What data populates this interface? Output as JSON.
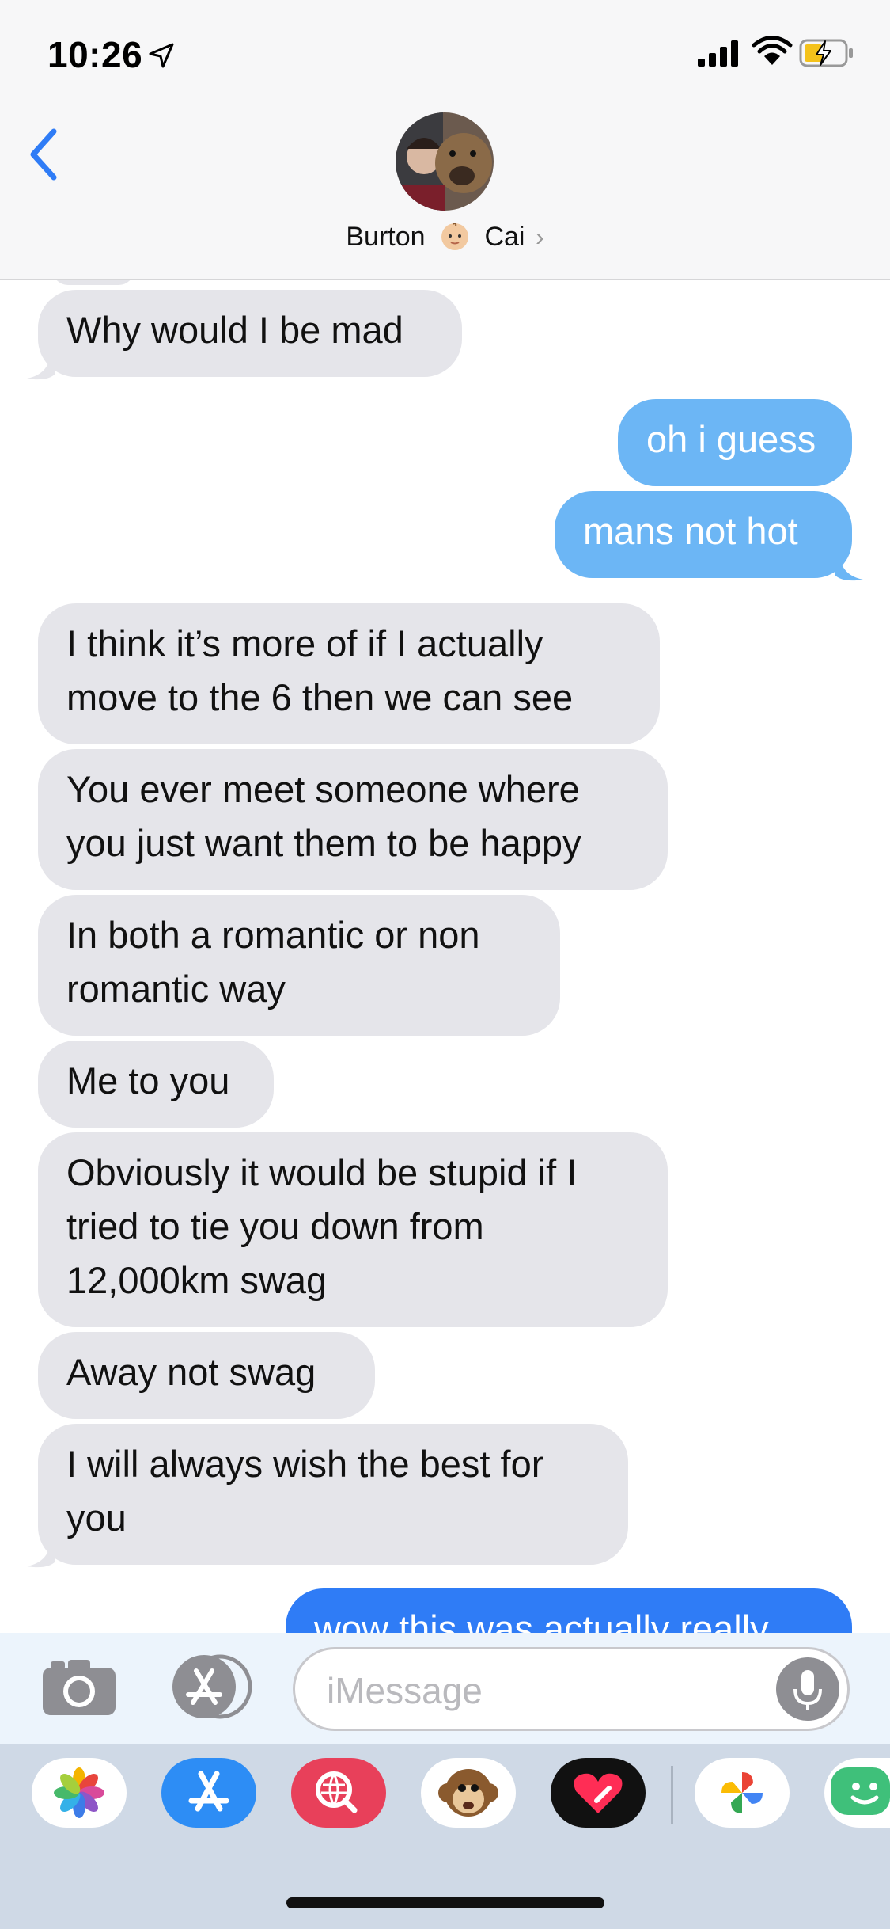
{
  "status_bar": {
    "time": "10:26"
  },
  "header": {
    "contact_name_1": "Burton",
    "contact_name_2": "Cai",
    "chevron": "›"
  },
  "messages": [
    {
      "dir": "recv",
      "text": "Why would I be mad"
    },
    {
      "dir": "sent",
      "text": "oh i guess"
    },
    {
      "dir": "sent",
      "text": "mans not hot"
    },
    {
      "dir": "recv",
      "text": "I think it’s more of if I actually\nmove to the 6 then we can see"
    },
    {
      "dir": "recv",
      "text": "You ever meet someone where\nyou just want them to be happy"
    },
    {
      "dir": "recv",
      "text": "In both a romantic or non\nromantic way"
    },
    {
      "dir": "recv",
      "text": "Me to you"
    },
    {
      "dir": "recv",
      "text": "Obviously it would be stupid if I\ntried to tie you down from\n12,000km swag"
    },
    {
      "dir": "recv",
      "text": "Away not swag"
    },
    {
      "dir": "recv",
      "text": "I will always wish the best for\nyou"
    },
    {
      "dir": "sent",
      "text": "wow this was actually really"
    }
  ],
  "composer": {
    "placeholder": "iMessage"
  },
  "icons": {
    "status": [
      "location-arrow-icon",
      "signal-icon",
      "wifi-icon",
      "battery-charging-icon"
    ],
    "header": [
      "back-chevron-icon",
      "avatar",
      "baby-emoji-icon"
    ],
    "composer": [
      "camera-icon",
      "app-store-icon",
      "microphone-icon"
    ],
    "tray": [
      "photos-app-icon",
      "app-store-app-icon",
      "web-search-app-icon",
      "animoji-monkey-icon",
      "digital-touch-icon",
      "google-photos-icon",
      "bitmoji-icon"
    ]
  },
  "colors": {
    "sent_bubble": "#6cb6f5",
    "sent_bubble_active": "#2f7cf6",
    "received_bubble": "#e5e5ea",
    "accent": "#2f7cf6"
  }
}
